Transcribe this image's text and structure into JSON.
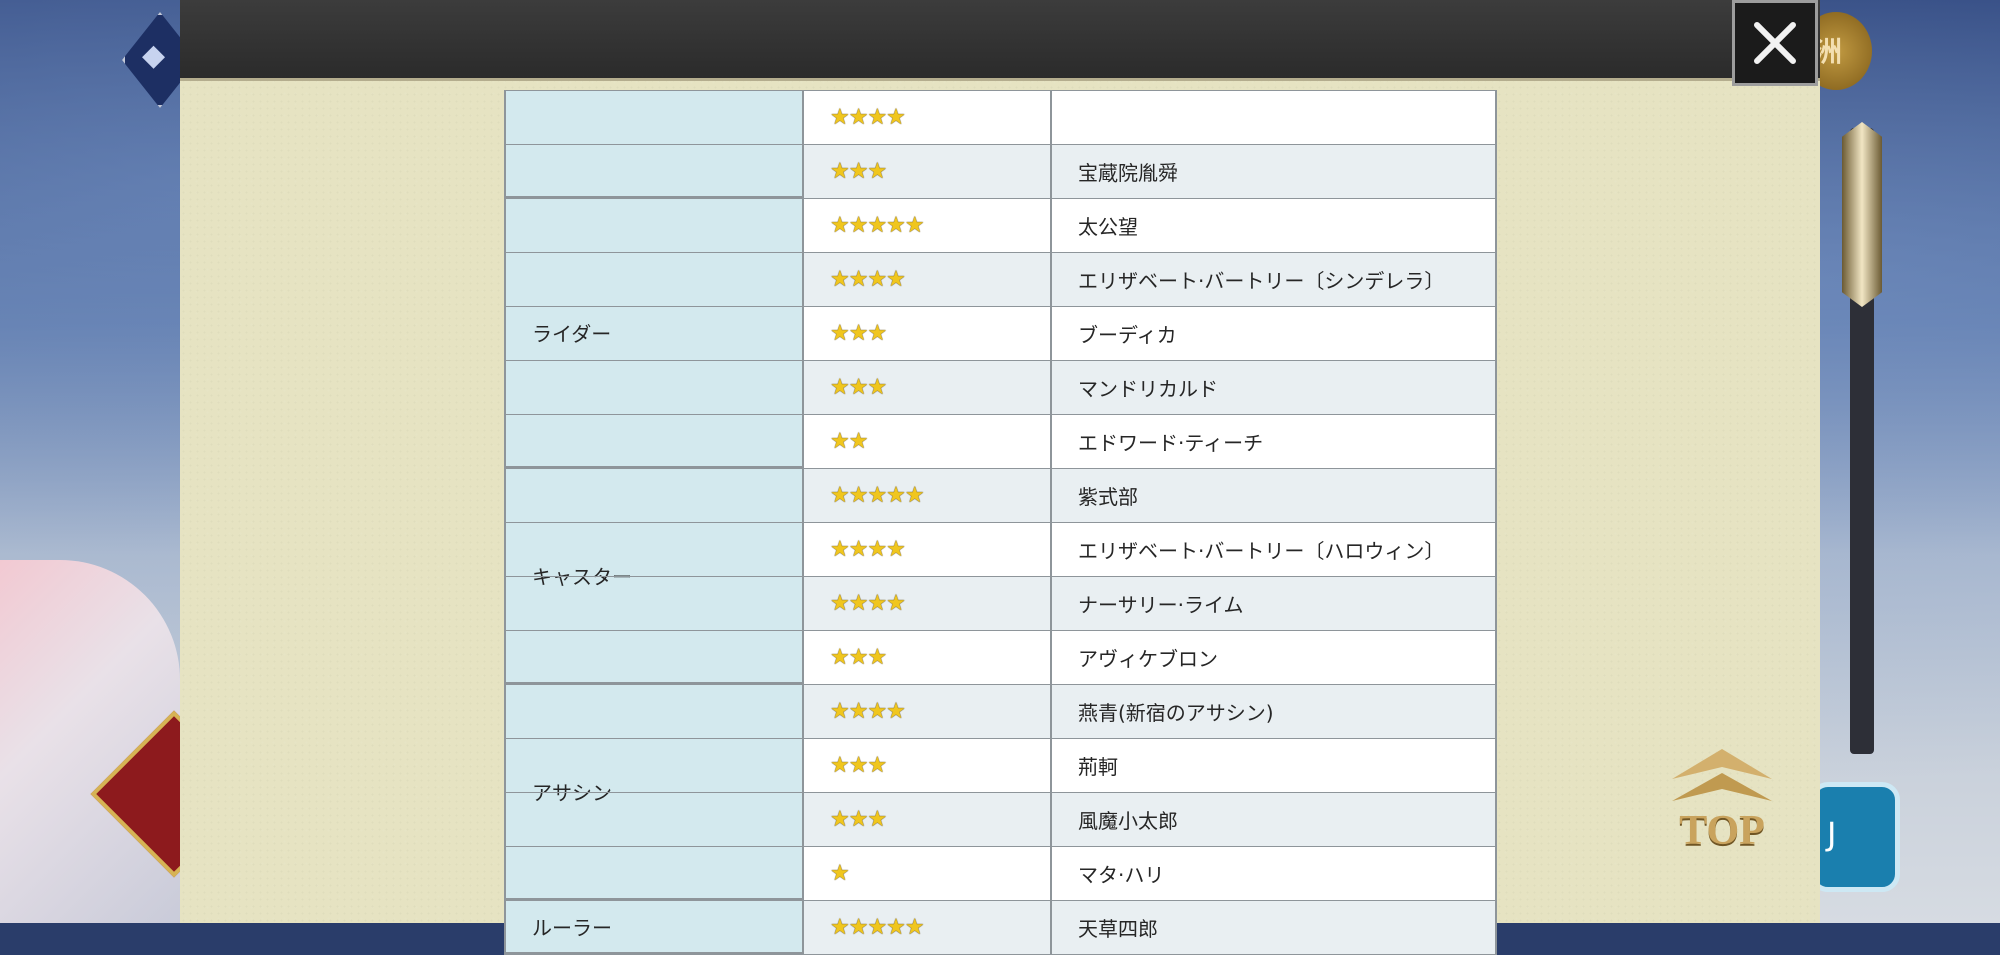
{
  "classes": [
    {
      "name": "",
      "rows": [
        {
          "stars": "★★★★",
          "name": ""
        },
        {
          "stars": "★★★",
          "name": "宝蔵院胤舜"
        }
      ]
    },
    {
      "name": "ライダー",
      "rows": [
        {
          "stars": "★★★★★",
          "name": "太公望"
        },
        {
          "stars": "★★★★",
          "name": "エリザベート·バートリー〔シンデレラ〕"
        },
        {
          "stars": "★★★",
          "name": "ブーディカ"
        },
        {
          "stars": "★★★",
          "name": "マンドリカルド"
        },
        {
          "stars": "★★",
          "name": "エドワード·ティーチ"
        }
      ]
    },
    {
      "name": "キャスター",
      "rows": [
        {
          "stars": "★★★★★",
          "name": "紫式部"
        },
        {
          "stars": "★★★★",
          "name": "エリザベート·バートリー〔ハロウィン〕"
        },
        {
          "stars": "★★★★",
          "name": "ナーサリー·ライム"
        },
        {
          "stars": "★★★",
          "name": "アヴィケブロン"
        }
      ]
    },
    {
      "name": "アサシン",
      "rows": [
        {
          "stars": "★★★★",
          "name": "燕青(新宿のアサシン)"
        },
        {
          "stars": "★★★",
          "name": "荊軻"
        },
        {
          "stars": "★★★",
          "name": "風魔小太郎"
        },
        {
          "stars": "★",
          "name": "マタ·ハリ"
        }
      ]
    },
    {
      "name": "ルーラー",
      "rows": [
        {
          "stars": "★★★★★",
          "name": "天草四郎"
        }
      ]
    }
  ],
  "top_button": {
    "label": "TOP"
  },
  "bg": {
    "coin_label": "洲",
    "right_button_label": "J"
  },
  "icons": {
    "close": "close-icon",
    "top": "chevron-up-icon"
  },
  "colors": {
    "class_cell": "#d3e9ee",
    "row_alt": "#e9eff2",
    "panel": "#e6e3c2",
    "star": "#f0c61e"
  }
}
